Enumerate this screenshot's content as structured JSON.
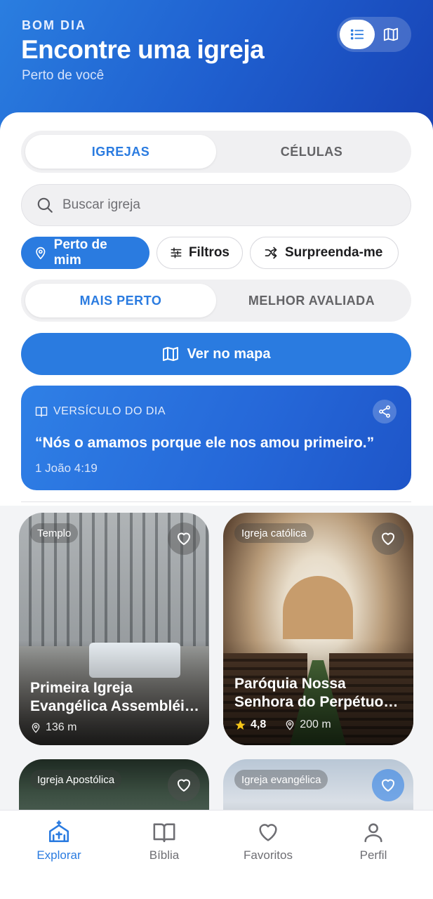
{
  "colors": {
    "primary": "#2a7be0",
    "header_start": "#2a7ee0",
    "header_end": "#1742b4",
    "text": "#1c1c1e",
    "muted": "#6e6e73"
  },
  "header": {
    "greeting": "BOM DIA",
    "title": "Encontre uma igreja",
    "subtitle": "Perto de você",
    "view_toggle": {
      "active": "list",
      "options": [
        "list-icon",
        "map-icon"
      ]
    }
  },
  "tabs_top": {
    "items": [
      "IGREJAS",
      "CÉLULAS"
    ],
    "active": 0
  },
  "search": {
    "placeholder": "Buscar igreja",
    "value": ""
  },
  "chips": [
    {
      "label": "Perto de mim",
      "icon": "location-pin-icon",
      "active": true
    },
    {
      "label": "Filtros",
      "icon": "sliders-icon",
      "active": false
    },
    {
      "label": "Surpreenda-me",
      "icon": "shuffle-icon",
      "active": false
    }
  ],
  "sort": {
    "items": [
      "MAIS PERTO",
      "MELHOR AVALIADA"
    ],
    "active": 0
  },
  "map_button": {
    "label": "Ver no mapa",
    "icon": "map-icon"
  },
  "verse": {
    "heading": "VERSÍCULO DO DIA",
    "text": "“Nós o amamos porque ele nos amou primeiro.”",
    "reference": "1 João 4:19"
  },
  "cards": [
    {
      "badge": "Templo",
      "title_line1": "Primeira Igreja",
      "title_line2": "Evangélica Assembléi…",
      "rating": null,
      "distance": "136 m"
    },
    {
      "badge": "Igreja católica",
      "title_line1": "Paróquia Nossa",
      "title_line2": "Senhora do Perpétuo…",
      "rating": "4,8",
      "distance": "200 m"
    },
    {
      "badge": "Igreja Apostólica"
    },
    {
      "badge": "Igreja evangélica"
    }
  ],
  "tabbar": {
    "items": [
      {
        "label": "Explorar",
        "icon": "church-icon",
        "active": true
      },
      {
        "label": "Bíblia",
        "icon": "book-icon",
        "active": false
      },
      {
        "label": "Favoritos",
        "icon": "heart-icon",
        "active": false
      },
      {
        "label": "Perfil",
        "icon": "user-icon",
        "active": false
      }
    ]
  }
}
